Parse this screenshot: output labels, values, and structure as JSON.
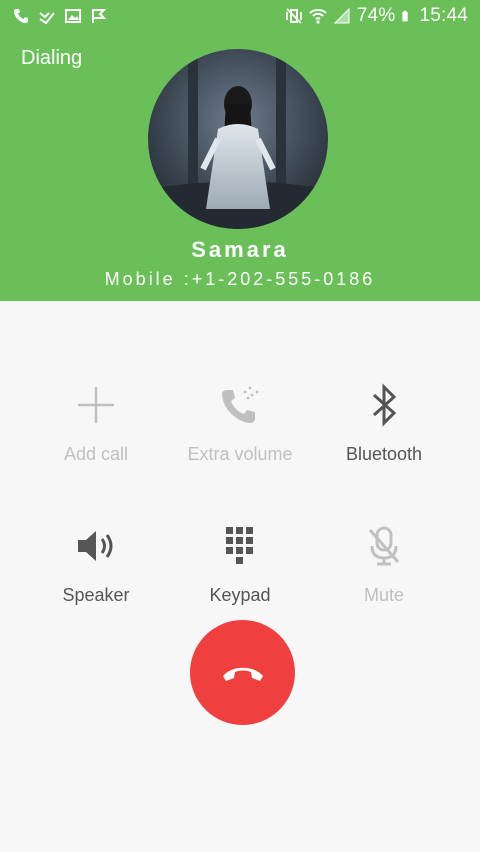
{
  "status_bar": {
    "battery": "74%",
    "time": "15:44",
    "left_icons": [
      "phone-icon",
      "missed-call-icon",
      "gallery-icon",
      "flag-icon"
    ],
    "right_icons": [
      "mute-vibrate-icon",
      "wifi-icon",
      "signal-icon",
      "battery-icon"
    ]
  },
  "call": {
    "state": "Dialing",
    "name": "Samara",
    "number": "Mobile :+1-202-555-0186"
  },
  "actions": [
    {
      "label": "Add call",
      "icon": "plus-icon",
      "enabled": false
    },
    {
      "label": "Extra volume",
      "icon": "extra-volume-icon",
      "enabled": false
    },
    {
      "label": "Bluetooth",
      "icon": "bluetooth-icon",
      "enabled": true
    },
    {
      "label": "Speaker",
      "icon": "speaker-icon",
      "enabled": true
    },
    {
      "label": "Keypad",
      "icon": "keypad-icon",
      "enabled": true
    },
    {
      "label": "Mute",
      "icon": "mute-mic-icon",
      "enabled": false
    }
  ],
  "end_call": {
    "icon": "end-call-icon"
  },
  "colors": {
    "header": "#6bbf59",
    "end_call": "#ef3f3f",
    "disabled": "#c0c0c0",
    "enabled": "#555555"
  }
}
